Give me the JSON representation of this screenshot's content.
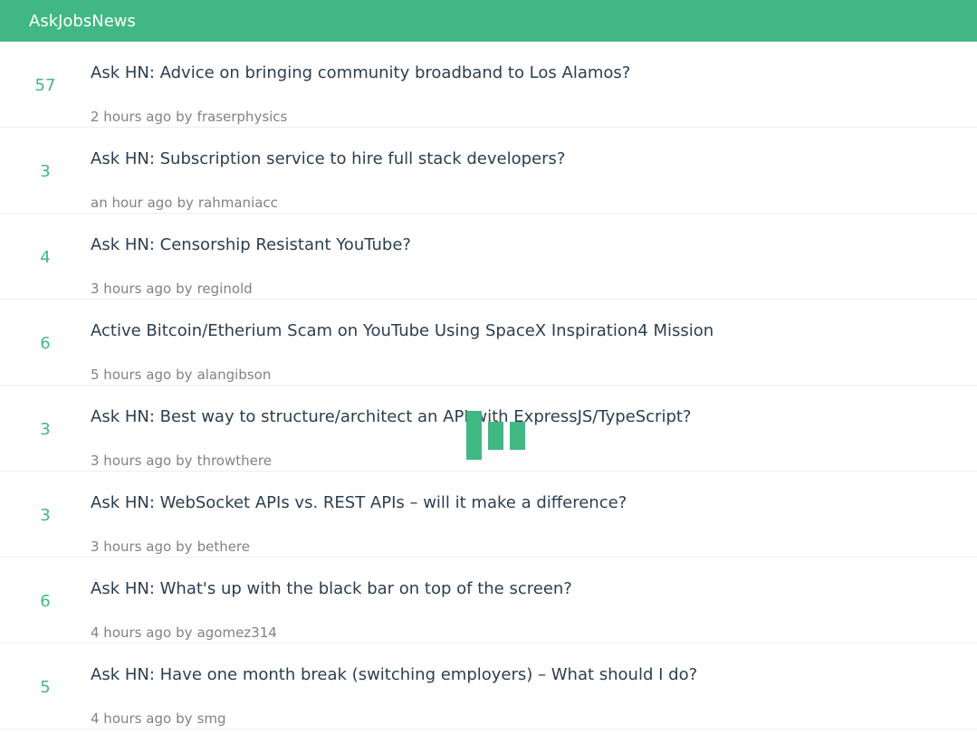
{
  "header": {
    "brand": "AskJobsNews"
  },
  "stories": [
    {
      "score": "57",
      "title": "Ask HN: Advice on bringing community broadband to Los Alamos?",
      "time": "2 hours ago",
      "by": "by",
      "author": "fraserphysics"
    },
    {
      "score": "3",
      "title": "Ask HN: Subscription service to hire full stack developers?",
      "time": "an hour ago",
      "by": "by",
      "author": "rahmaniacc"
    },
    {
      "score": "4",
      "title": "Ask HN: Censorship Resistant YouTube?",
      "time": "3 hours ago",
      "by": "by",
      "author": "reginold"
    },
    {
      "score": "6",
      "title": "Active Bitcoin/Etherium Scam on YouTube Using SpaceX Inspiration4 Mission",
      "time": "5 hours ago",
      "by": "by",
      "author": "alangibson"
    },
    {
      "score": "3",
      "title": "Ask HN: Best way to structure/architect an API with ExpressJS/TypeScript?",
      "time": "3 hours ago",
      "by": "by",
      "author": "throwthere"
    },
    {
      "score": "3",
      "title": "Ask HN: WebSocket APIs vs. REST APIs – will it make a difference?",
      "time": "3 hours ago",
      "by": "by",
      "author": "bethere"
    },
    {
      "score": "6",
      "title": "Ask HN: What's up with the black bar on top of the screen?",
      "time": "4 hours ago",
      "by": "by",
      "author": "agomez314"
    },
    {
      "score": "5",
      "title": "Ask HN: Have one month break (switching employers) – What should I do?",
      "time": "4 hours ago",
      "by": "by",
      "author": "smg"
    }
  ],
  "loader": {
    "icon": "loading-spinner-icon"
  }
}
